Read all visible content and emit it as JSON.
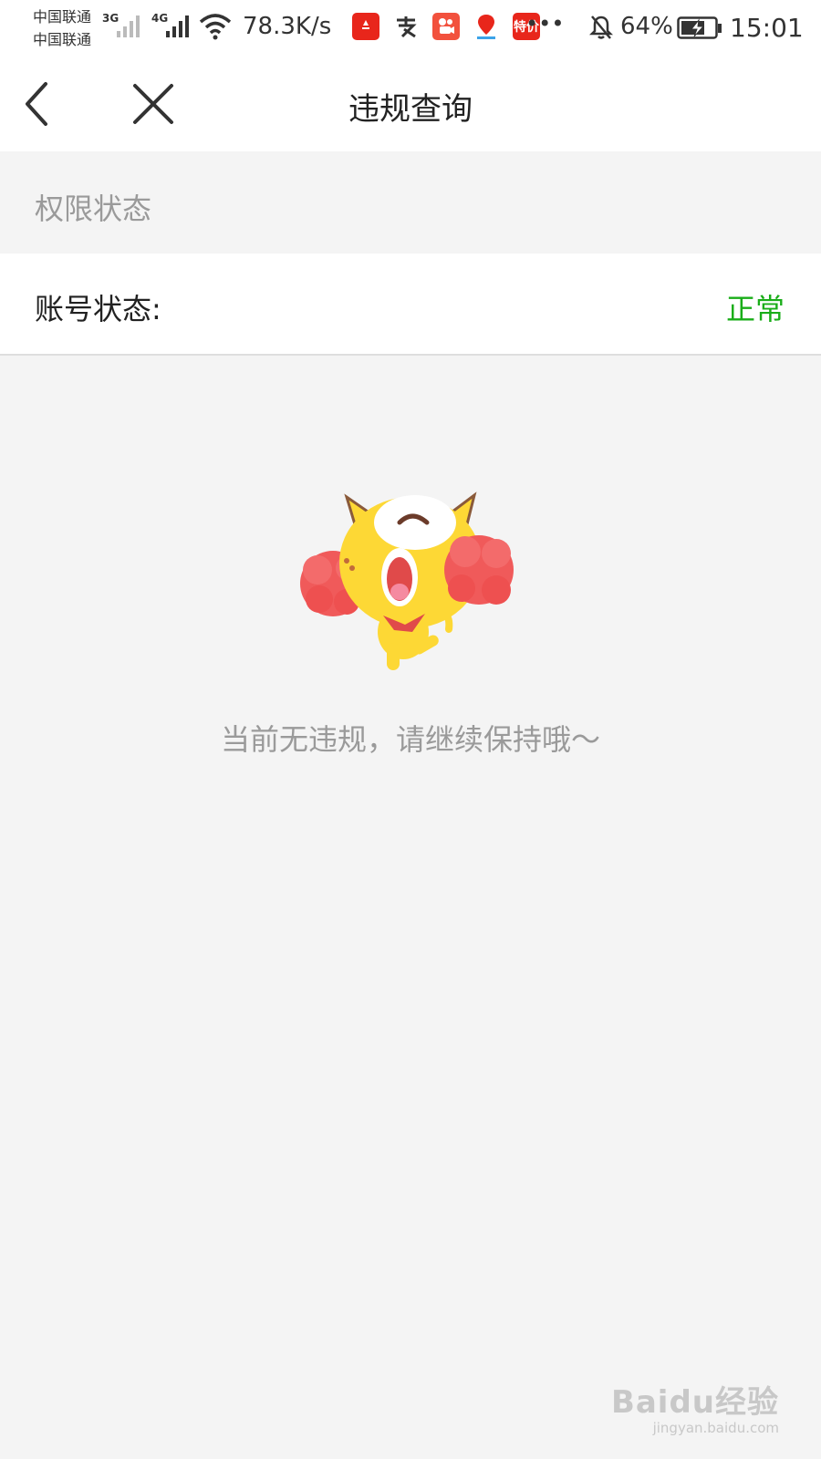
{
  "status_bar": {
    "carrier1": "中国联通",
    "carrier2": "中国联通",
    "net1": "3G",
    "net2": "4G",
    "speed": "78.3K/s",
    "battery_pct": "64%",
    "time": "15:01",
    "app_icons": [
      {
        "icon": "app-red-icon",
        "color": "#e8261b"
      },
      {
        "icon": "alipay-icon",
        "color": "#ffffff"
      },
      {
        "icon": "kuaishou-icon",
        "color": "#f2513d"
      },
      {
        "icon": "map-pin-icon",
        "color": "#ffffff"
      },
      {
        "icon": "tejia-icon",
        "color": "#e8261b",
        "label": "特价"
      }
    ]
  },
  "navbar": {
    "title": "违规查询"
  },
  "section": {
    "title": "权限状态"
  },
  "account": {
    "label": "账号状态:",
    "value": "正常",
    "value_color": "#1aad19"
  },
  "empty_state": {
    "message": "当前无违规，请继续保持哦～"
  },
  "watermark": {
    "logo": "Baidu经验",
    "url": "jingyan.baidu.com"
  }
}
